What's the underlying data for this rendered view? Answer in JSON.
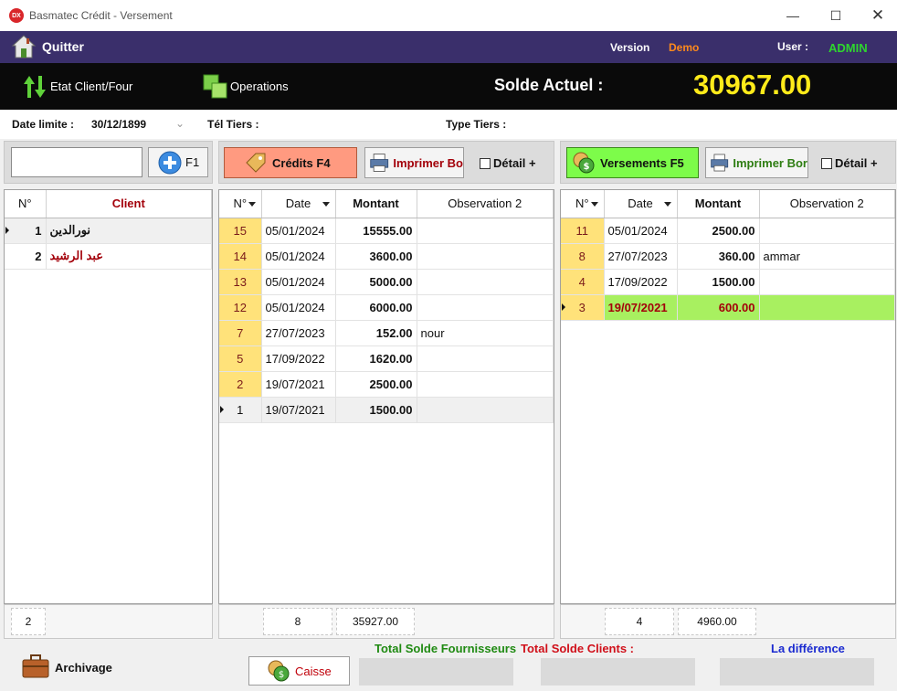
{
  "window": {
    "title": "Basmatec Crédit - Versement",
    "icon_text": "DX"
  },
  "topbar": {
    "quit_label": "Quitter",
    "version_label": "Version",
    "version_value": "Demo",
    "user_label": "User :",
    "user_value": "ADMIN"
  },
  "toolbar": {
    "etat_label": "Etat Client/Four",
    "operations_label": "Operations",
    "solde_label": "Solde Actuel :",
    "solde_value": "30967.00"
  },
  "info": {
    "date_label": "Date limite :",
    "date_value": "30/12/1899",
    "tel_label": "Tél Tiers :",
    "type_label": "Type Tiers :"
  },
  "clients": {
    "search_value": "",
    "add_label": "F1",
    "headers": [
      "N°",
      "Client"
    ],
    "rows": [
      {
        "n": "1",
        "name": "نورالدين"
      },
      {
        "n": "2",
        "name": "عبد الرشيد"
      }
    ],
    "count": "2"
  },
  "credits": {
    "button_label": "Crédits F4",
    "print_label": "Imprimer Bo",
    "detail_label": "Détail +",
    "headers": [
      "N°",
      "Date",
      "Montant",
      "Observation 2"
    ],
    "rows": [
      {
        "n": "15",
        "date": "05/01/2024",
        "montant": "15555.00",
        "obs": ""
      },
      {
        "n": "14",
        "date": "05/01/2024",
        "montant": "3600.00",
        "obs": ""
      },
      {
        "n": "13",
        "date": "05/01/2024",
        "montant": "5000.00",
        "obs": ""
      },
      {
        "n": "12",
        "date": "05/01/2024",
        "montant": "6000.00",
        "obs": ""
      },
      {
        "n": "7",
        "date": "27/07/2023",
        "montant": "152.00",
        "obs": "nour"
      },
      {
        "n": "5",
        "date": "17/09/2022",
        "montant": "1620.00",
        "obs": ""
      },
      {
        "n": "2",
        "date": "19/07/2021",
        "montant": "2500.00",
        "obs": ""
      },
      {
        "n": "1",
        "date": "19/07/2021",
        "montant": "1500.00",
        "obs": ""
      }
    ],
    "count": "8",
    "total": "35927.00"
  },
  "versements": {
    "button_label": "Versements F5",
    "print_label": "Imprimer Bor",
    "detail_label": "Détail +",
    "headers": [
      "N°",
      "Date",
      "Montant",
      "Observation 2"
    ],
    "rows": [
      {
        "n": "11",
        "date": "05/01/2024",
        "montant": "2500.00",
        "obs": ""
      },
      {
        "n": "8",
        "date": "27/07/2023",
        "montant": "360.00",
        "obs": "ammar"
      },
      {
        "n": "4",
        "date": "17/09/2022",
        "montant": "1500.00",
        "obs": ""
      },
      {
        "n": "3",
        "date": "19/07/2021",
        "montant": "600.00",
        "obs": ""
      }
    ],
    "count": "4",
    "total": "4960.00"
  },
  "bottom": {
    "archivage_label": "Archivage",
    "caisse_label": "Caisse",
    "total_fournisseurs_label": "Total Solde Fournisseurs",
    "total_clients_label": "Total Solde Clients :",
    "difference_label": "La différence"
  },
  "colors": {
    "header_purple": "#3a2f6b",
    "solde_yellow": "#ffeb1a",
    "admin_green": "#2ed62e",
    "credits_btn": "#ff9a80",
    "versements_btn": "#7dfc4a",
    "selected_row": "#a8f060"
  }
}
